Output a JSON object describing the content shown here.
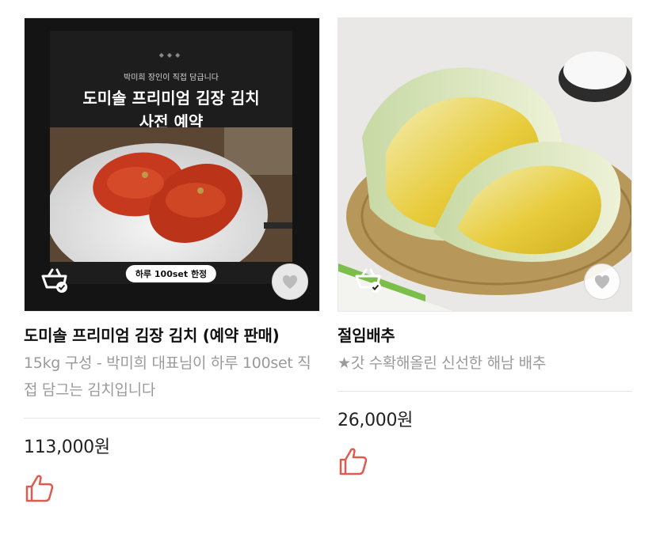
{
  "products": [
    {
      "title": "도미솔 프리미엄 김장 김치 (예약 판매)",
      "subtitle": "15kg 구성 - 박미희 대표님이 하루 100set 직접 담그는 김치입니다",
      "price": "113,000원",
      "image": {
        "kicker": "박미희 장인이 직접 담급니다",
        "title_line1": "도미솔 프리미엄 김장 김치",
        "title_line2": "사전 예약",
        "chip": "하루 100set 한정"
      }
    },
    {
      "title": "절임배추",
      "subtitle": "★갓 수확해올린 신선한 해남 배추",
      "price": "26,000원"
    }
  ],
  "icons": {
    "cart": "cart-check-icon",
    "heart": "heart-icon",
    "like": "thumbs-up-icon"
  },
  "colors": {
    "like_red": "#e05a4f",
    "price_text": "#222222",
    "subtitle_gray": "#9a9a9a"
  }
}
